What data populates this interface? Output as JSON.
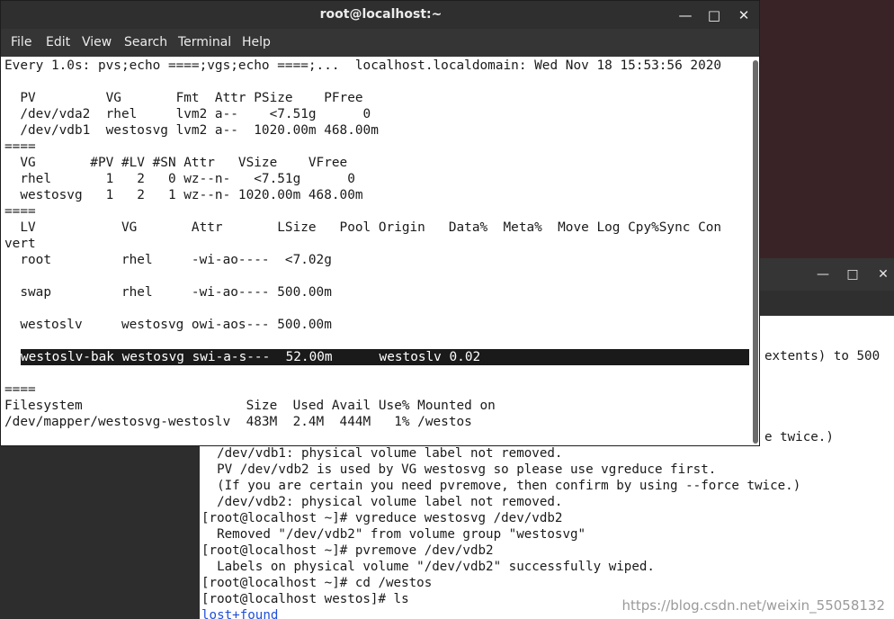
{
  "front_window": {
    "title": "root@localhost:~",
    "controls": {
      "minimize": "—",
      "maximize": "□",
      "close": "✕"
    },
    "menu": [
      "File",
      "Edit",
      "View",
      "Search",
      "Terminal",
      "Help"
    ],
    "lines": [
      "Every 1.0s: pvs;echo ====;vgs;echo ====;...  localhost.localdomain: Wed Nov 18 15:53:56 2020",
      "",
      "  PV         VG       Fmt  Attr PSize    PFree",
      "  /dev/vda2  rhel     lvm2 a--    <7.51g      0",
      "  /dev/vdb1  westosvg lvm2 a--  1020.00m 468.00m",
      "====",
      "  VG       #PV #LV #SN Attr   VSize    VFree",
      "  rhel       1   2   0 wz--n-   <7.51g      0",
      "  westosvg   1   2   1 wz--n- 1020.00m 468.00m",
      "====",
      "  LV           VG       Attr       LSize   Pool Origin   Data%  Meta%  Move Log Cpy%Sync Con",
      "vert",
      "  root         rhel     -wi-ao----  <7.02g",
      "",
      "  swap         rhel     -wi-ao---- 500.00m",
      "",
      "  westoslv     westosvg owi-aos--- 500.00m",
      "",
      "westoslv-bak westosvg swi-a-s---  52.00m      westoslv 0.02",
      "",
      "====",
      "Filesystem                     Size  Used Avail Use% Mounted on",
      "/dev/mapper/westosvg-westoslv  483M  2.4M  444M   1% /westos"
    ]
  },
  "back_window": {
    "controls": {
      "minimize": "—",
      "maximize": "□",
      "close": "✕"
    },
    "partial_lines": [
      {
        "text": "extents) to 500"
      },
      {
        "text": "e twice.)"
      }
    ],
    "lines": [
      "  /dev/vdb1: physical volume label not removed.",
      "  PV /dev/vdb2 is used by VG westosvg so please use vgreduce first.",
      "  (If you are certain you need pvremove, then confirm by using --force twice.)",
      "  /dev/vdb2: physical volume label not removed.",
      "[root@localhost ~]# vgreduce westosvg /dev/vdb2",
      "  Removed \"/dev/vdb2\" from volume group \"westosvg\"",
      "[root@localhost ~]# pvremove /dev/vdb2",
      "  Labels on physical volume \"/dev/vdb2\" successfully wiped.",
      "[root@localhost ~]# cd /westos",
      "[root@localhost westos]# ls",
      "lost+found"
    ],
    "watermark": "https://blog.csdn.net/weixin_55058132"
  }
}
